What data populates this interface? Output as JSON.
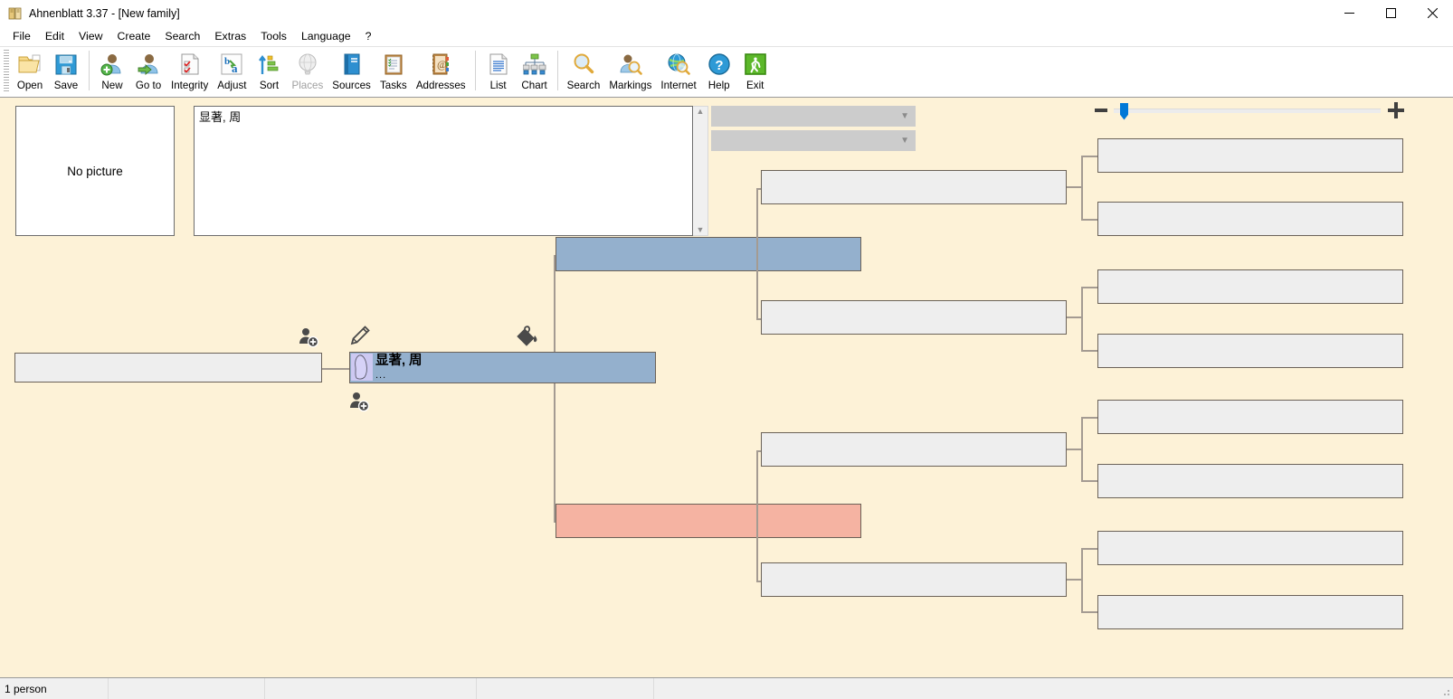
{
  "window": {
    "title": "Ahnenblatt 3.37 - [New family]",
    "app_icon": "ahnenblatt-logo-icon",
    "controls": {
      "minimize": "—",
      "maximize": "☐",
      "close": "✕"
    }
  },
  "menubar": {
    "items": [
      {
        "label": "File"
      },
      {
        "label": "Edit"
      },
      {
        "label": "View"
      },
      {
        "label": "Create"
      },
      {
        "label": "Search"
      },
      {
        "label": "Extras"
      },
      {
        "label": "Tools"
      },
      {
        "label": "Language"
      },
      {
        "label": "?"
      }
    ]
  },
  "toolbar": {
    "groups": [
      {
        "buttons": [
          {
            "label": "Open",
            "icon": "open-folder-icon",
            "enabled": true
          },
          {
            "label": "Save",
            "icon": "floppy-disk-icon",
            "enabled": true
          }
        ]
      },
      {
        "buttons": [
          {
            "label": "New",
            "icon": "person-add-icon",
            "enabled": true
          },
          {
            "label": "Go to",
            "icon": "person-goto-icon",
            "enabled": true
          },
          {
            "label": "Integrity",
            "icon": "checklist-page-icon",
            "enabled": true
          },
          {
            "label": "Adjust",
            "icon": "ba-letters-icon",
            "enabled": true
          },
          {
            "label": "Sort",
            "icon": "sort-bars-icon",
            "enabled": true
          },
          {
            "label": "Places",
            "icon": "globe-icon",
            "enabled": false
          },
          {
            "label": "Sources",
            "icon": "blue-book-icon",
            "enabled": true
          },
          {
            "label": "Tasks",
            "icon": "clipboard-icon",
            "enabled": true
          },
          {
            "label": "Addresses",
            "icon": "address-book-icon",
            "enabled": true
          }
        ]
      },
      {
        "buttons": [
          {
            "label": "List",
            "icon": "list-page-icon",
            "enabled": true
          },
          {
            "label": "Chart",
            "icon": "org-chart-icon",
            "enabled": true
          }
        ]
      },
      {
        "buttons": [
          {
            "label": "Search",
            "icon": "magnifier-icon",
            "enabled": true
          },
          {
            "label": "Markings",
            "icon": "person-magnifier-icon",
            "enabled": true
          },
          {
            "label": "Internet",
            "icon": "globe-magnifier-icon",
            "enabled": true
          },
          {
            "label": "Help",
            "icon": "question-circle-icon",
            "enabled": true
          },
          {
            "label": "Exit",
            "icon": "exit-door-icon",
            "enabled": true
          }
        ]
      }
    ]
  },
  "detail_panel": {
    "picture_placeholder": "No picture",
    "notes_text": "显著, 周",
    "scroll_up_icon": "chevron-up-icon",
    "scroll_down_icon": "chevron-down-icon",
    "combo_top": {
      "value": "",
      "caret_icon": "chevron-down-icon"
    },
    "combo_bottom": {
      "value": "",
      "caret_icon": "chevron-down-icon"
    }
  },
  "zoom_control": {
    "minus_icon": "minus-icon",
    "plus_icon": "plus-icon",
    "thumb_position_percent": 3
  },
  "chart": {
    "background_color": "#fdf2d7",
    "selected_person": {
      "name": "显著, 周",
      "subtitle": "...",
      "avatar_icon": "person-silhouette-icon",
      "box_color": "#94b0cd"
    },
    "father_box_color": "#94b0cd",
    "mother_box_color": "#f5b3a2",
    "empty_box_color": "#eeeeee",
    "line_color": "#a49b92",
    "action_icons": [
      {
        "name": "add-person-above-icon",
        "icon": "person-plus-icon"
      },
      {
        "name": "edit-person-icon",
        "icon": "pencil-icon"
      },
      {
        "name": "fill-color-icon",
        "icon": "paint-bucket-icon"
      },
      {
        "name": "add-person-below-icon",
        "icon": "person-plus-icon"
      }
    ],
    "empty_nodes_count": 13
  },
  "statusbar": {
    "cells": [
      {
        "text": "1 person"
      },
      {
        "text": ""
      },
      {
        "text": ""
      },
      {
        "text": ""
      },
      {
        "text": ""
      }
    ],
    "resize_grip_icon": "resize-grip-icon"
  }
}
